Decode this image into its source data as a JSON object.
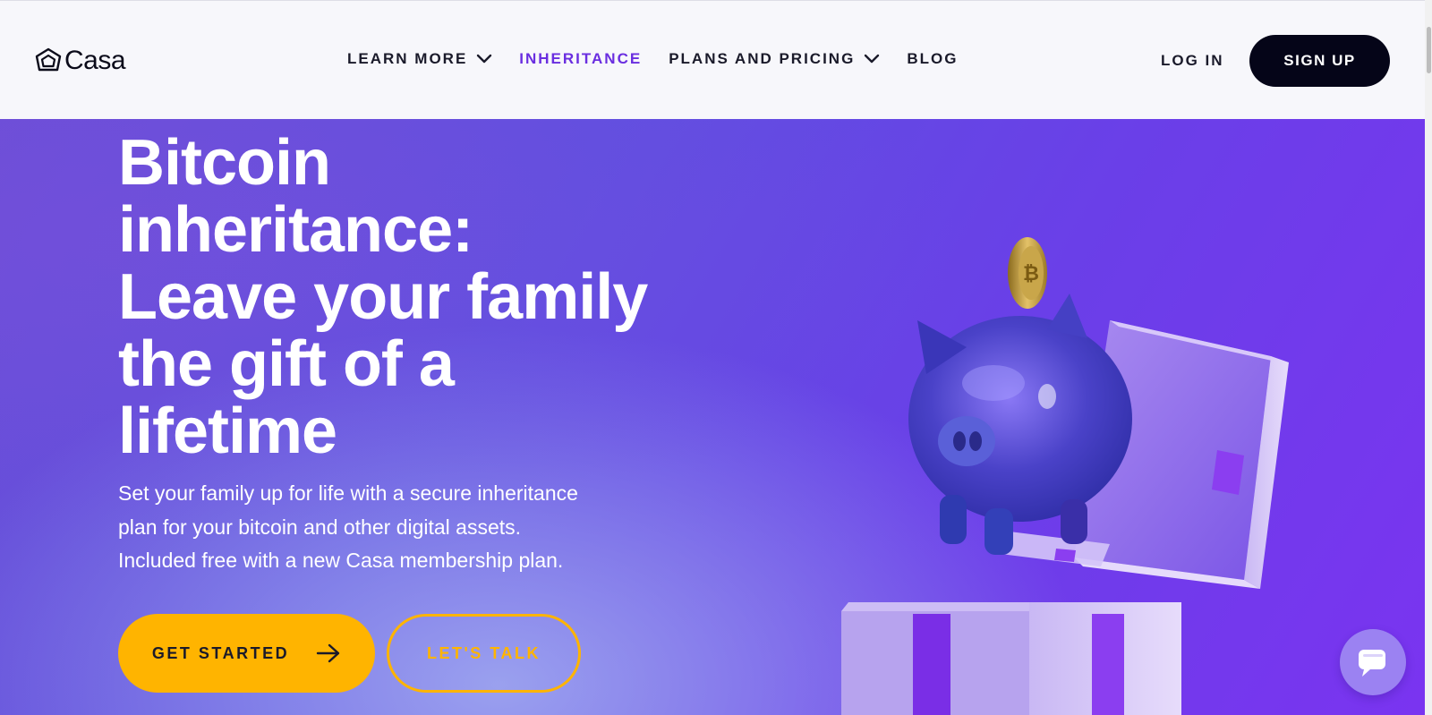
{
  "brand": {
    "name": "Casa",
    "logo_icon": "casa-hexagon-house-icon"
  },
  "nav": {
    "items": [
      {
        "label": "LEARN MORE",
        "has_dropdown": true,
        "active": false
      },
      {
        "label": "INHERITANCE",
        "has_dropdown": false,
        "active": true
      },
      {
        "label": "PLANS AND PRICING",
        "has_dropdown": true,
        "active": false
      },
      {
        "label": "BLOG",
        "has_dropdown": false,
        "active": false
      }
    ],
    "login_label": "LOG IN",
    "signup_label": "SIGN UP"
  },
  "hero": {
    "title_lines": [
      "Bitcoin",
      "inheritance:",
      "Leave your family",
      "the gift of a",
      "lifetime"
    ],
    "subtitle_lines": [
      "Set your family up for life with a secure inheritance",
      "plan for your bitcoin and other digital assets.",
      "Included free with a new Casa membership plan."
    ],
    "primary_cta": "GET STARTED",
    "secondary_cta": "LET'S TALK",
    "illustration": "piggy-bank-gift-box-bitcoin-coin"
  },
  "chat_widget": {
    "icon": "chat-bubble-icon"
  },
  "colors": {
    "accent_active_nav": "#6a2ee0",
    "cta_yellow": "#ffb400",
    "signup_bg": "#050518",
    "hero_purple": "#6a3fe8"
  }
}
